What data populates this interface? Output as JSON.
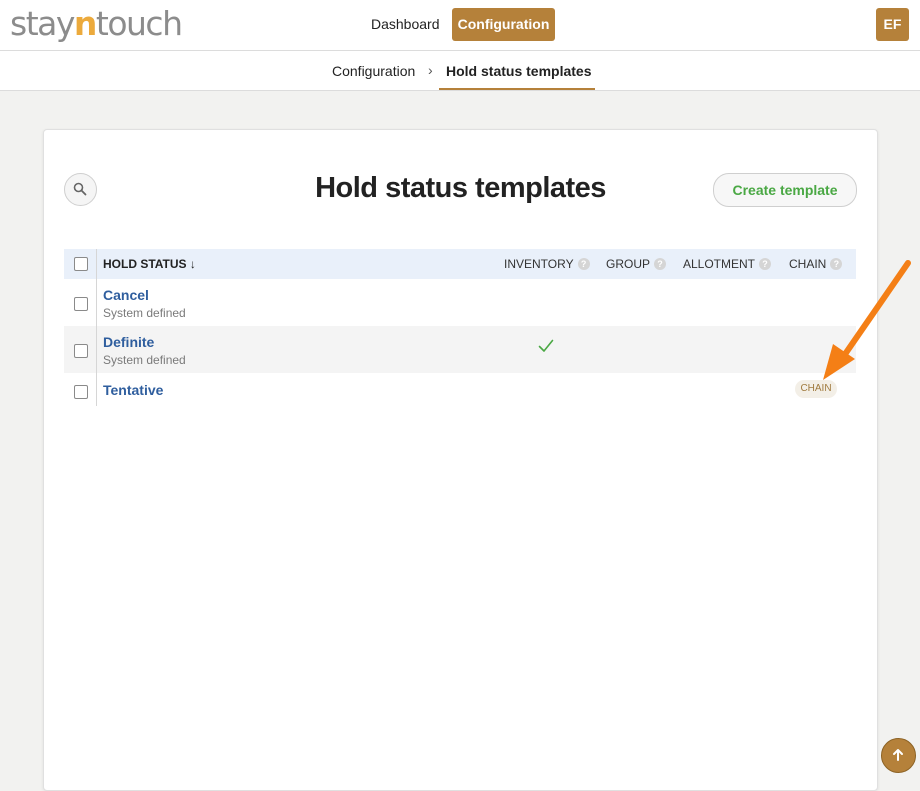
{
  "app": {
    "logo_pre": "stay",
    "logo_n": "n",
    "logo_post": "touch"
  },
  "nav": {
    "dashboard": "Dashboard",
    "configuration": "Configuration",
    "avatar_initials": "EF"
  },
  "breadcrumb": {
    "root": "Configuration",
    "separator": "›",
    "current": "Hold status templates"
  },
  "page": {
    "title": "Hold status templates",
    "create_button": "Create template"
  },
  "table": {
    "columns": {
      "hold_status": "HOLD STATUS ↓",
      "inventory": "INVENTORY",
      "group": "GROUP",
      "allotment": "ALLOTMENT",
      "chain": "CHAIN"
    },
    "help_glyph": "?",
    "rows": [
      {
        "name": "Cancel",
        "subtitle": "System defined",
        "inventory": false,
        "chain": ""
      },
      {
        "name": "Definite",
        "subtitle": "System defined",
        "inventory": true,
        "chain": ""
      },
      {
        "name": "Tentative",
        "subtitle": "",
        "inventory": false,
        "chain": "CHAIN"
      }
    ]
  },
  "colors": {
    "accent": "#b5813a",
    "logo_highlight": "#ecaa3c",
    "link": "#2f5e9e",
    "success": "#4aa844",
    "annotation_arrow": "#f47f16"
  },
  "icons": {
    "search": "search-icon",
    "check": "check-icon",
    "back_to_top": "arrow-up-icon"
  }
}
